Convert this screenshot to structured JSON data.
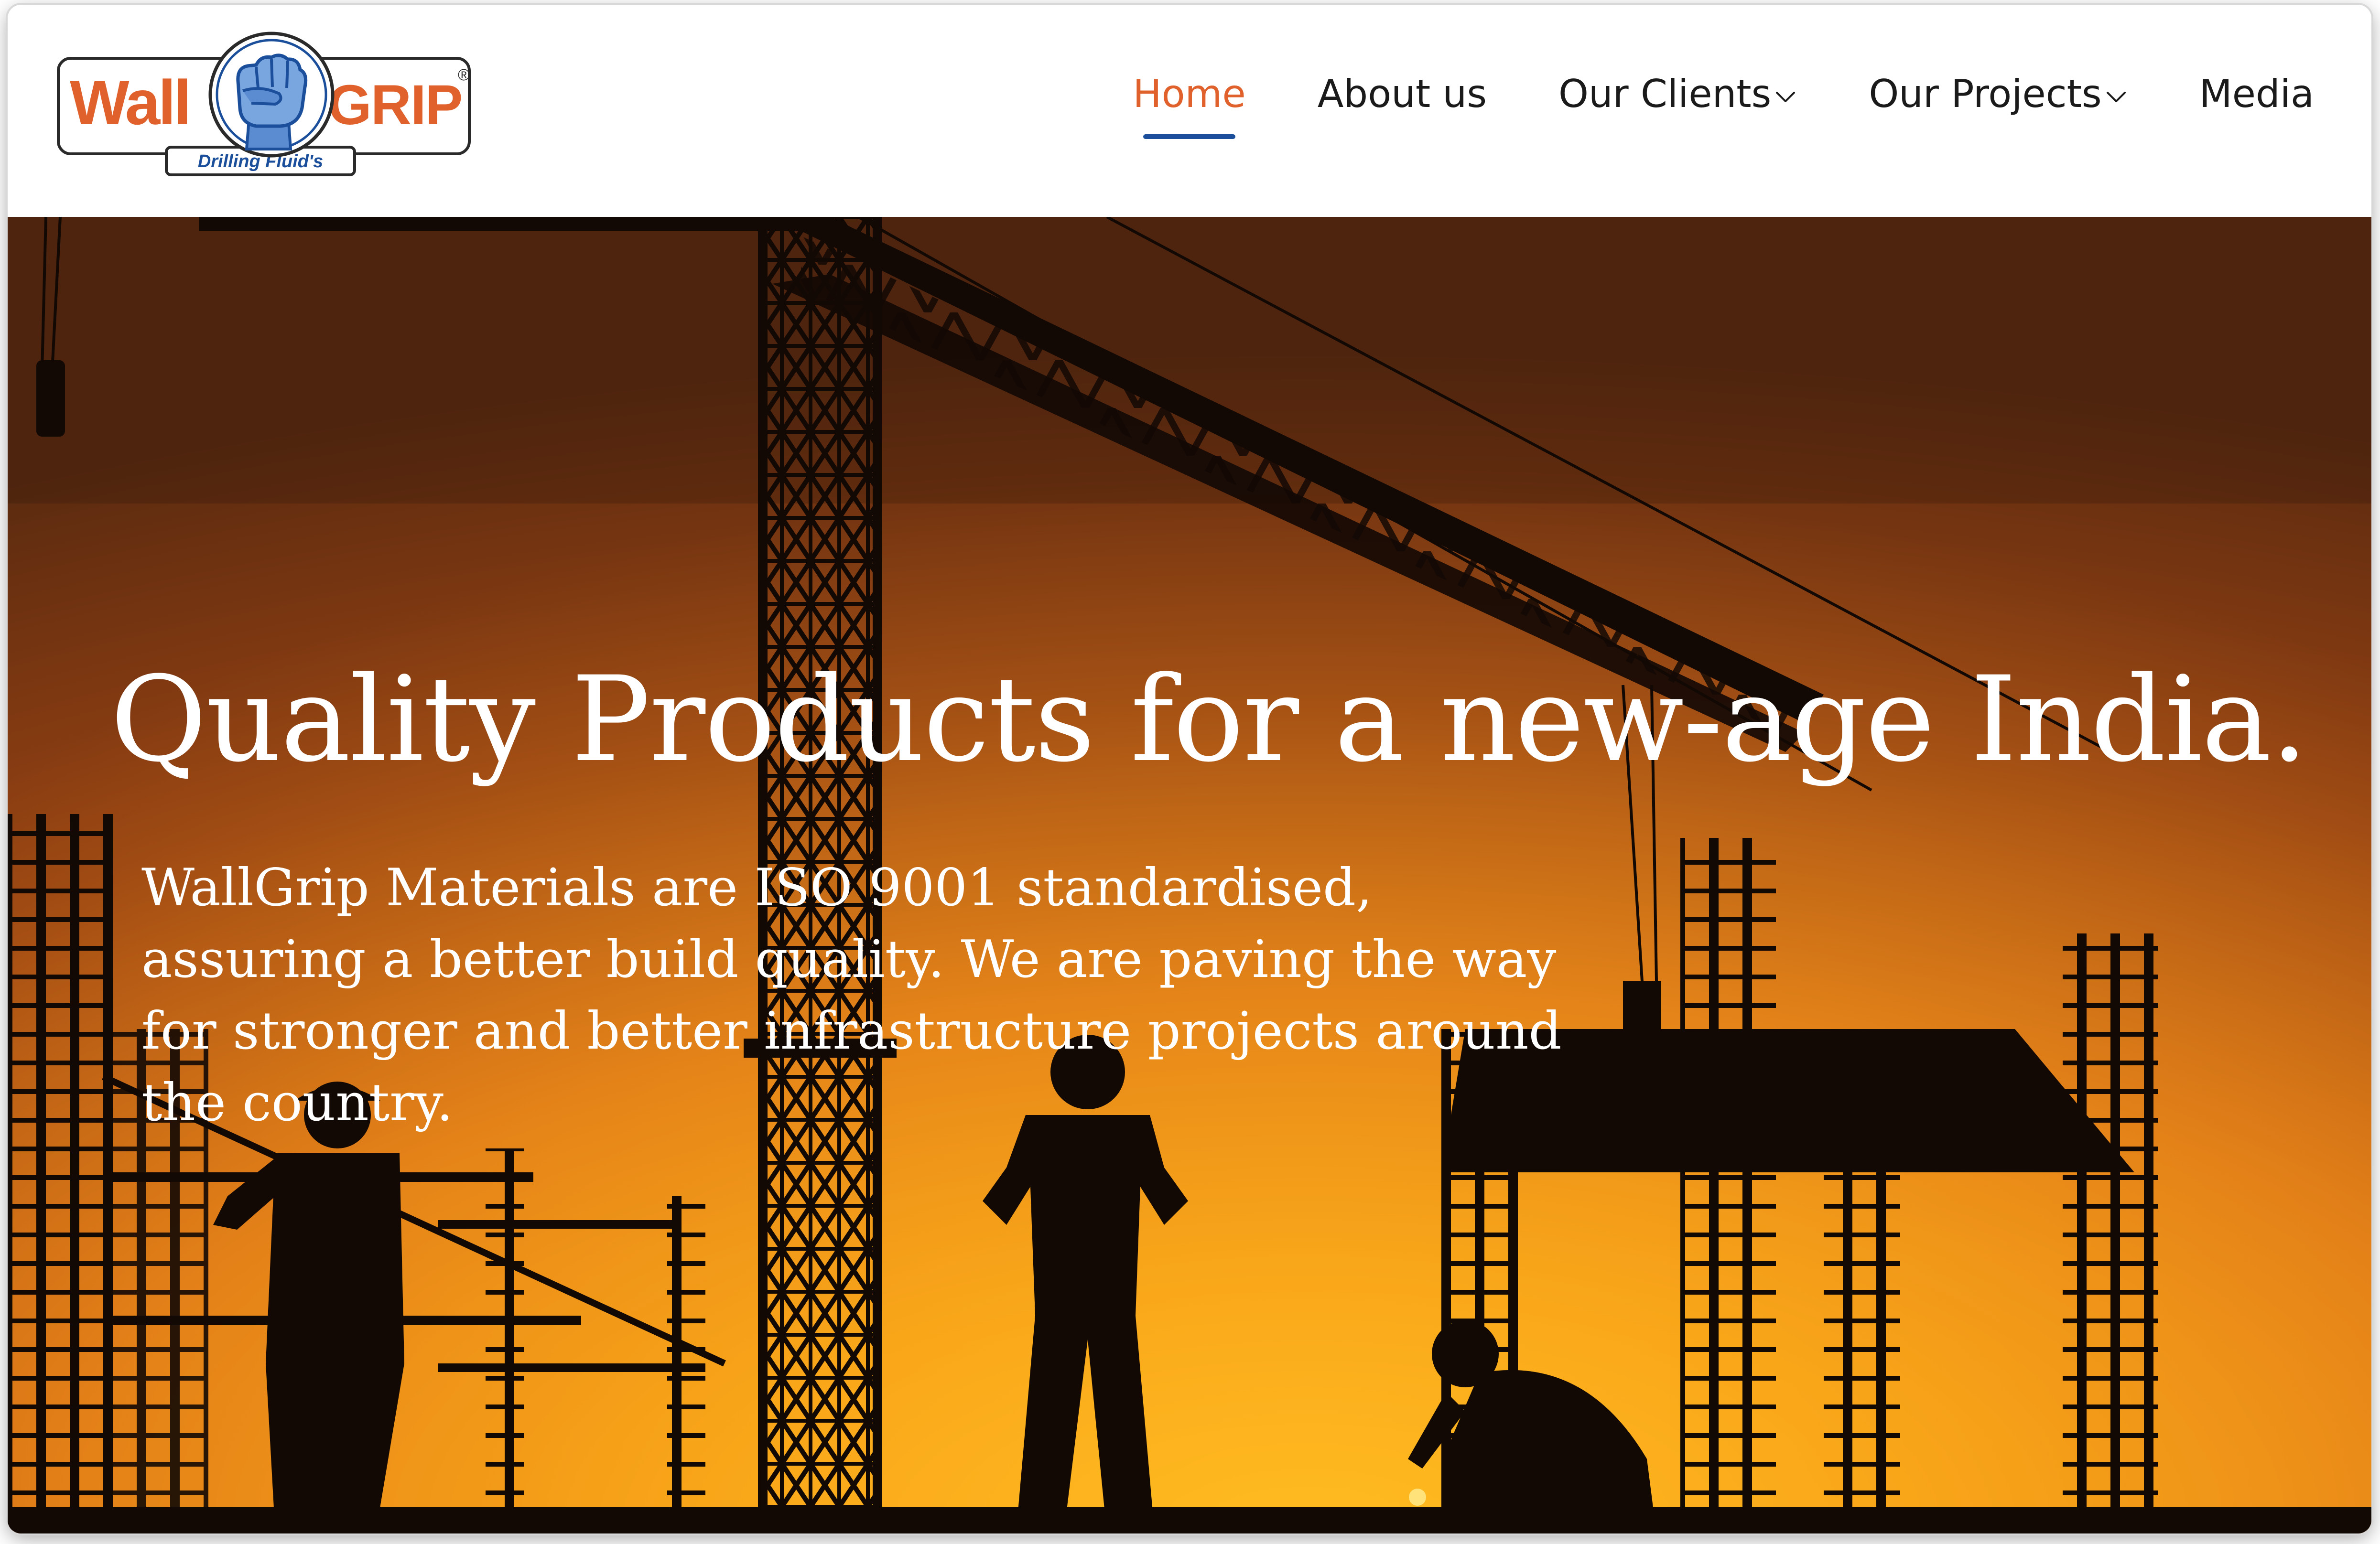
{
  "brand": {
    "name_left": "Wall",
    "name_right": "GRIP",
    "registered_mark": "®",
    "tagline": "Drilling Fluid's",
    "colors": {
      "orange": "#e0612c",
      "blue": "#1b4e9b"
    }
  },
  "nav": {
    "items": [
      {
        "label": "Home",
        "active": true,
        "has_dropdown": false
      },
      {
        "label": "About us",
        "active": false,
        "has_dropdown": false
      },
      {
        "label": "Our Clients",
        "active": false,
        "has_dropdown": true
      },
      {
        "label": "Our Projects",
        "active": false,
        "has_dropdown": true
      },
      {
        "label": "Media",
        "active": false,
        "has_dropdown": false
      }
    ],
    "dropdown_icon": "chevron-down-icon"
  },
  "hero": {
    "title": "Quality Products for a new-age India.",
    "description": "WallGrip Materials are ISO 9001 standardised, assuring a better build quality. We are paving the way for stronger and better infrastructure projects around the country.",
    "background": "construction-site-silhouette-at-sunset"
  }
}
